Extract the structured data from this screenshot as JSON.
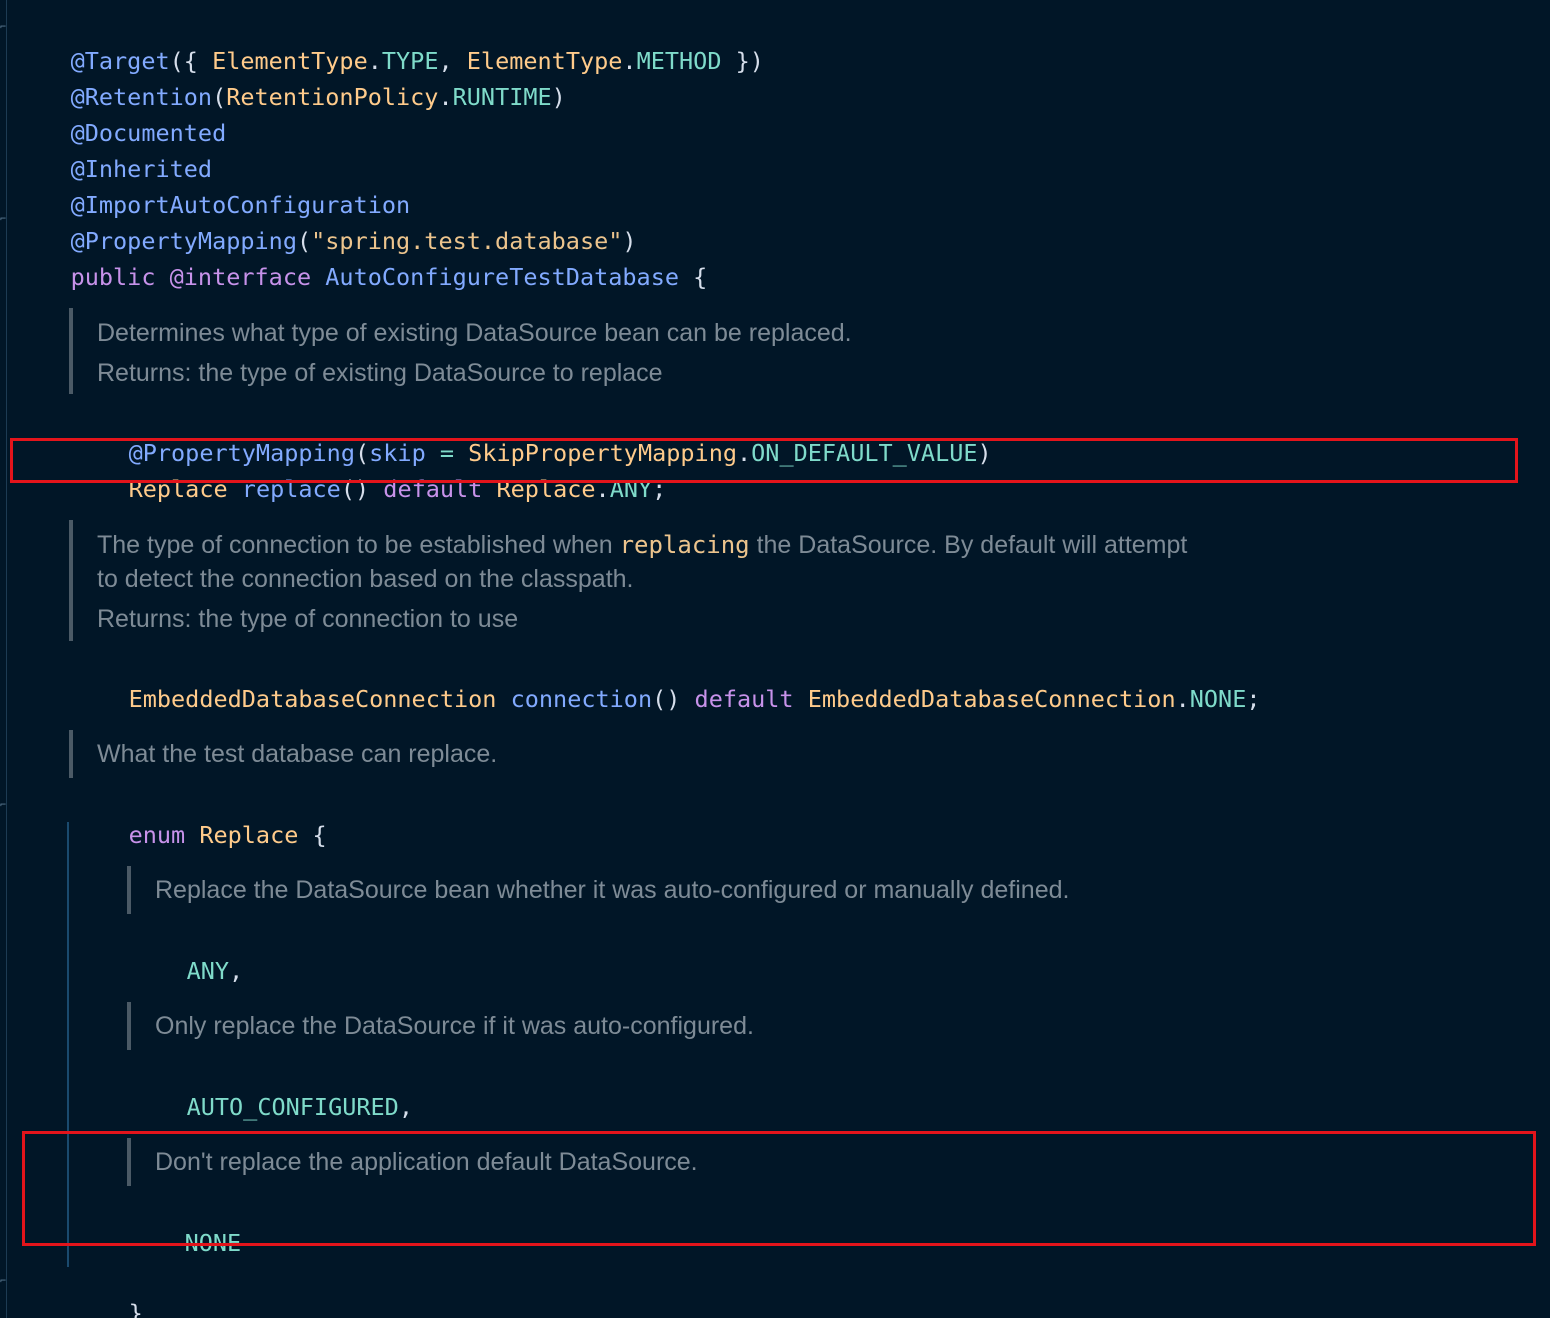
{
  "editor": {
    "colors": {
      "background": "#011627",
      "annotation": "#82aaff",
      "type": "#ffcb8b",
      "constant": "#7fdbca",
      "keyword": "#c792ea",
      "doc": "#7e8b96",
      "highlight": "#e3141b"
    },
    "header": {
      "line1": {
        "at_target": "@Target",
        "open": "({ ",
        "t1": "ElementType",
        "dot1": ".",
        "c1": "TYPE",
        "comma": ", ",
        "t2": "ElementType",
        "dot2": ".",
        "c2": "METHOD",
        "close": " })"
      },
      "line2": {
        "anno": "@Retention",
        "open": "(",
        "t": "RetentionPolicy",
        "dot": ".",
        "c": "RUNTIME",
        "close": ")"
      },
      "line3": {
        "anno": "@Documented"
      },
      "line4": {
        "anno": "@Inherited"
      },
      "line5": {
        "anno": "@ImportAutoConfiguration"
      },
      "line6": {
        "anno": "@PropertyMapping",
        "open": "(",
        "str": "\"spring.test.database\"",
        "close": ")"
      },
      "line7": {
        "kw1": "public",
        "kw2": "@interface",
        "name": "AutoConfigureTestDatabase",
        "brace": " {"
      }
    },
    "replace_doc": {
      "line1": "Determines what type of existing DataSource bean can be replaced.",
      "line2": "Returns: the type of existing DataSource to replace"
    },
    "replace_member": {
      "anno": "@PropertyMapping",
      "open": "(",
      "param": "skip",
      "eq": " = ",
      "type": "SkipPropertyMapping",
      "dot": ".",
      "const": "ON_DEFAULT_VALUE",
      "close": ")",
      "decl_type": "Replace",
      "method": "replace",
      "parens": "()",
      "kw_default": "default",
      "value_type": "Replace",
      "value_dot": ".",
      "value_const": "ANY",
      "semi": ";"
    },
    "connection_doc": {
      "line1_pre": "The type of connection to be established when ",
      "line1_code": "replacing",
      "line1_post": " the DataSource. By default will attempt",
      "line2": "to detect the connection based on the classpath.",
      "line3": "Returns: the type of connection to use"
    },
    "connection_member": {
      "decl_type": "EmbeddedDatabaseConnection",
      "method": "connection",
      "parens": "()",
      "kw_default": "default",
      "value_type": "EmbeddedDatabaseConnection",
      "value_dot": ".",
      "value_const": "NONE",
      "semi": ";"
    },
    "enum_doc": {
      "line1": "What the test database can replace."
    },
    "enum_decl": {
      "kw": "enum",
      "name": "Replace",
      "brace": " {"
    },
    "enum_values": [
      {
        "doc": "Replace the DataSource bean whether it was auto-configured or manually defined.",
        "name": "ANY",
        "sep": ","
      },
      {
        "doc": "Only replace the DataSource if it was auto-configured.",
        "name": "AUTO_CONFIGURED",
        "sep": ","
      },
      {
        "doc": "Don't replace the application default DataSource.",
        "name": "NONE",
        "sep": ""
      }
    ],
    "enum_close": "}"
  }
}
